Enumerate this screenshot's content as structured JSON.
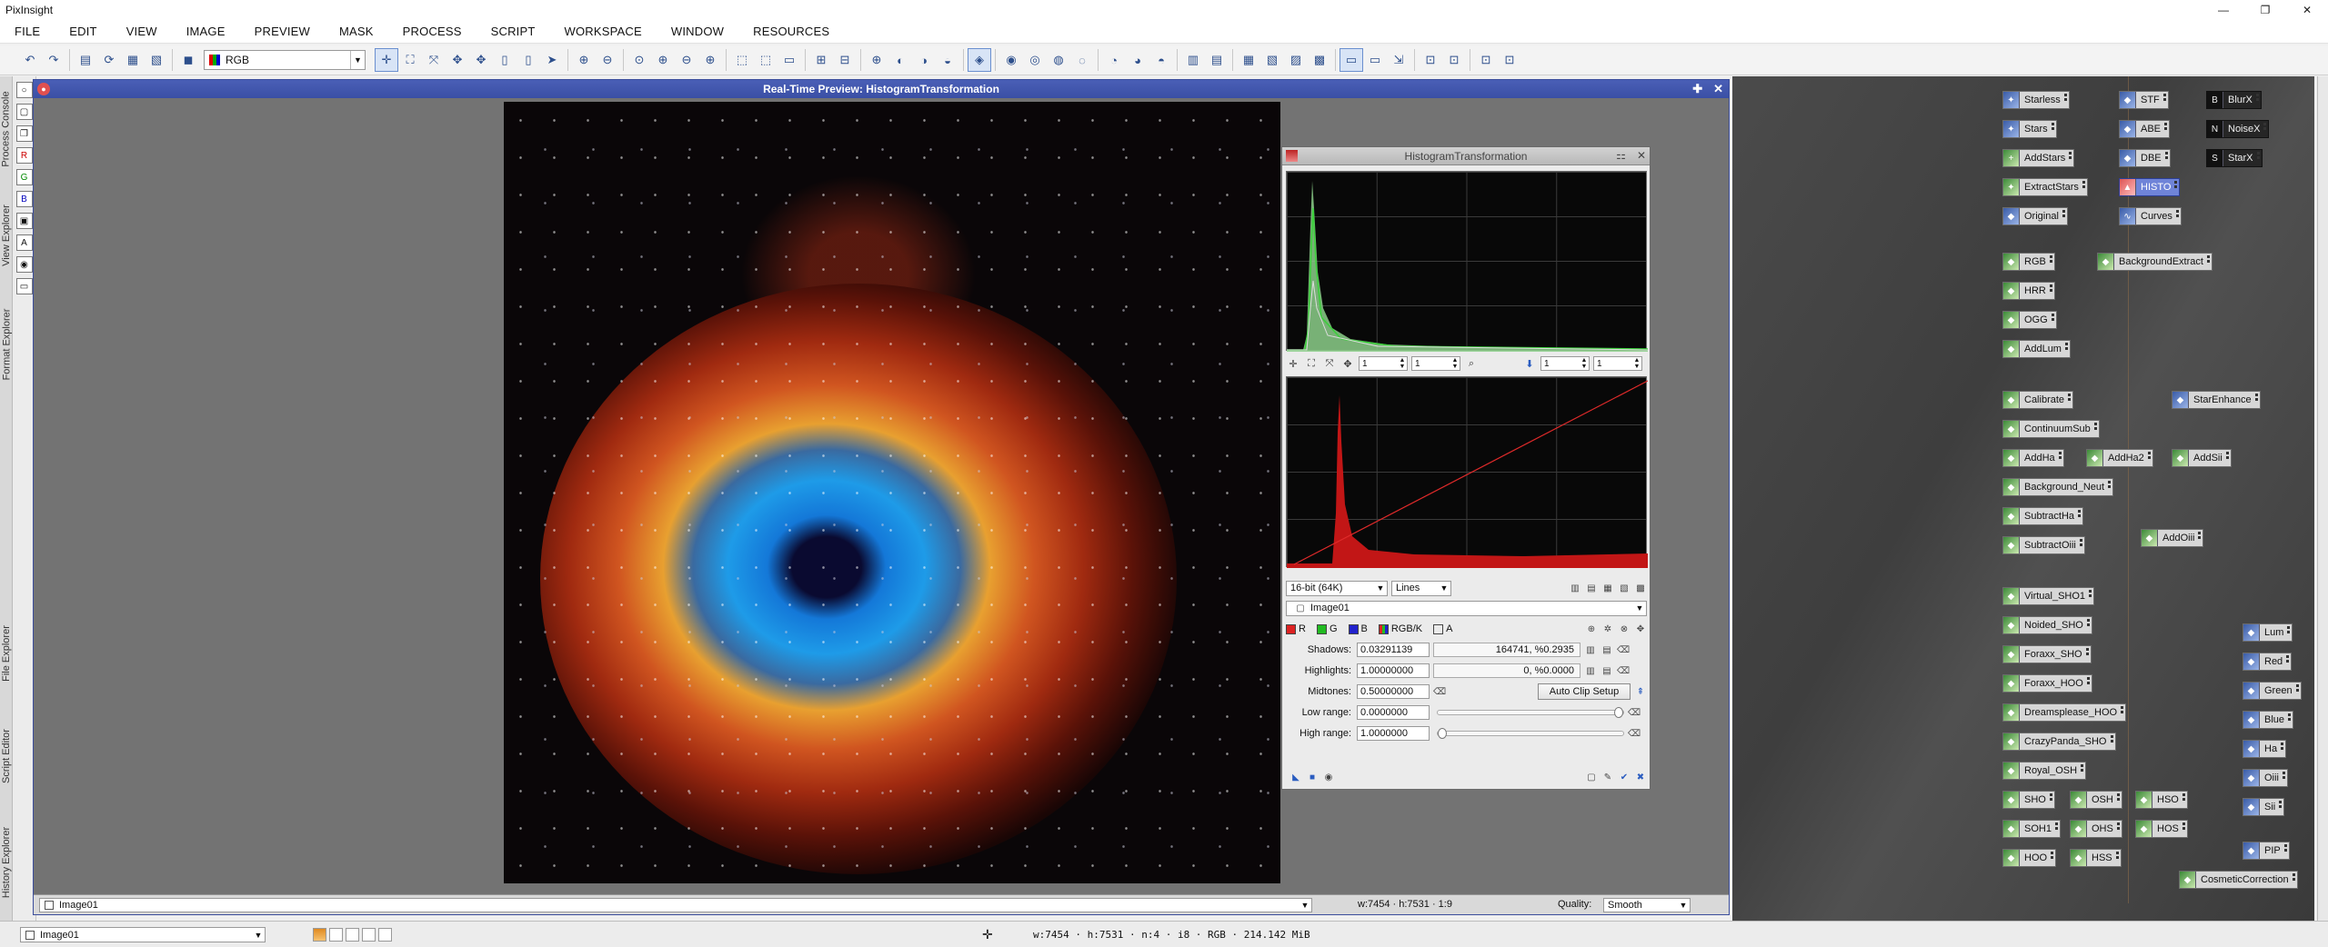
{
  "window": {
    "title": "PixInsight",
    "controls": [
      "—",
      "❐",
      "✕"
    ]
  },
  "menu": [
    "FILE",
    "EDIT",
    "VIEW",
    "IMAGE",
    "PREVIEW",
    "MASK",
    "PROCESS",
    "SCRIPT",
    "WORKSPACE",
    "WINDOW",
    "RESOURCES"
  ],
  "toolbar": {
    "channel_select": "RGB"
  },
  "side_tabs": [
    "Process Console",
    "View Explorer",
    "Format Explorer",
    "File Explorer",
    "Script Editor",
    "History Explorer"
  ],
  "preview": {
    "title": "Real-Time Preview: HistogramTransformation",
    "image_select": "Image01",
    "geometry": "w:7454 · h:7531 · 1:9",
    "quality_label": "Quality:",
    "quality_value": "Smooth"
  },
  "histogram": {
    "title": "HistogramTransformation",
    "zoom_x": "1",
    "zoom_y": "1",
    "zoom_x2": "1",
    "zoom_y2": "1",
    "resolution": "16-bit (64K)",
    "graph_style": "Lines",
    "view_select": "Image01",
    "channels": [
      "R",
      "G",
      "B",
      "RGB/K",
      "A"
    ],
    "shadows_label": "Shadows:",
    "shadows_value": "0.03291139",
    "shadows_stat": "164741, %0.2935",
    "highlights_label": "Highlights:",
    "highlights_value": "1.00000000",
    "highlights_stat": "0, %0.0000",
    "midtones_label": "Midtones:",
    "midtones_value": "0.50000000",
    "auto_clip": "Auto Clip Setup",
    "low_label": "Low range:",
    "low_value": "0.0000000",
    "high_label": "High range:",
    "high_value": "1.0000000",
    "low_slider": 1.0,
    "high_slider": 0.0
  },
  "workspace_icons": [
    {
      "label": "Starless",
      "glyph": "✦"
    },
    {
      "label": "Stars",
      "glyph": "✦"
    },
    {
      "label": "AddStars",
      "glyph": "+"
    },
    {
      "label": "ExtractStars",
      "glyph": "✦"
    },
    {
      "label": "Original",
      "glyph": "◆"
    },
    {
      "label": "STF",
      "glyph": "◆"
    },
    {
      "label": "ABE",
      "glyph": "◆"
    },
    {
      "label": "DBE",
      "glyph": "◆"
    },
    {
      "label": "HISTO",
      "glyph": "▲"
    },
    {
      "label": "Curves",
      "glyph": "∿"
    },
    {
      "label": "BlurX",
      "glyph": "B"
    },
    {
      "label": "NoiseX",
      "glyph": "N"
    },
    {
      "label": "StarX",
      "glyph": "S"
    },
    {
      "label": "RGB",
      "glyph": "◆"
    },
    {
      "label": "HRR",
      "glyph": "◆"
    },
    {
      "label": "OGG",
      "glyph": "◆"
    },
    {
      "label": "AddLum",
      "glyph": "◆"
    },
    {
      "label": "BackgroundExtract",
      "glyph": "◆"
    },
    {
      "label": "Calibrate",
      "glyph": "◆"
    },
    {
      "label": "ContinuumSub",
      "glyph": "◆"
    },
    {
      "label": "AddHa",
      "glyph": "◆"
    },
    {
      "label": "AddHa2",
      "glyph": "◆"
    },
    {
      "label": "AddSii",
      "glyph": "◆"
    },
    {
      "label": "Background_Neut",
      "glyph": "◆"
    },
    {
      "label": "SubtractHa",
      "glyph": "◆"
    },
    {
      "label": "SubtractOiii",
      "glyph": "◆"
    },
    {
      "label": "StarEnhance",
      "glyph": "◆"
    },
    {
      "label": "AddOiii",
      "glyph": "◆"
    },
    {
      "label": "Virtual_SHO1",
      "glyph": "◆"
    },
    {
      "label": "Noided_SHO",
      "glyph": "◆"
    },
    {
      "label": "Foraxx_SHO",
      "glyph": "◆"
    },
    {
      "label": "Foraxx_HOO",
      "glyph": "◆"
    },
    {
      "label": "Dreamsplease_HOO",
      "glyph": "◆"
    },
    {
      "label": "CrazyPanda_SHO",
      "glyph": "◆"
    },
    {
      "label": "Royal_OSH",
      "glyph": "◆"
    },
    {
      "label": "SHO",
      "glyph": "◆"
    },
    {
      "label": "OSH",
      "glyph": "◆"
    },
    {
      "label": "HSO",
      "glyph": "◆"
    },
    {
      "label": "SOH1",
      "glyph": "◆"
    },
    {
      "label": "OHS",
      "glyph": "◆"
    },
    {
      "label": "HOS",
      "glyph": "◆"
    },
    {
      "label": "HOO",
      "glyph": "◆"
    },
    {
      "label": "HSS",
      "glyph": "◆"
    },
    {
      "label": "Lum",
      "glyph": "◆"
    },
    {
      "label": "Red",
      "glyph": "◆"
    },
    {
      "label": "Green",
      "glyph": "◆"
    },
    {
      "label": "Blue",
      "glyph": "◆"
    },
    {
      "label": "Ha",
      "glyph": "◆"
    },
    {
      "label": "Oiii",
      "glyph": "◆"
    },
    {
      "label": "Sii",
      "glyph": "◆"
    },
    {
      "label": "PIP",
      "glyph": "◆"
    },
    {
      "label": "CosmeticCorrection",
      "glyph": "◆"
    }
  ],
  "statusbar": {
    "view_select": "Image01",
    "info": "w:7454 · h:7531 · n:4 · i8 · RGB · 214.142 MiB"
  }
}
